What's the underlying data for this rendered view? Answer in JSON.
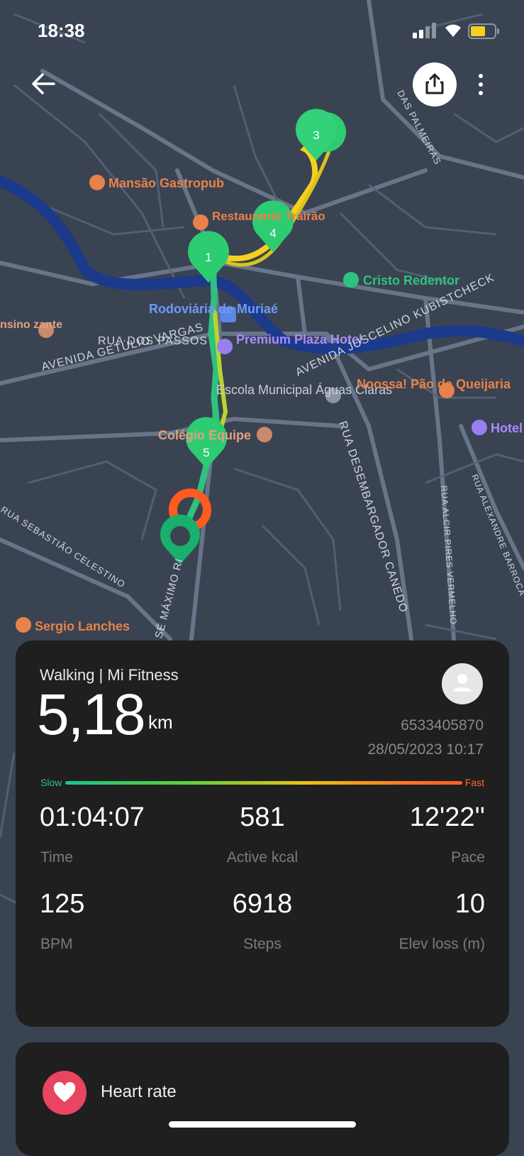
{
  "status_bar": {
    "time": "18:38"
  },
  "map": {
    "pois": [
      {
        "name": "Mansão Gastropub",
        "icon": "restaurant-icon"
      },
      {
        "name": "Restaurante Trairão",
        "icon": "restaurant-icon"
      },
      {
        "name": "Rodoviária de Muriaé",
        "icon": "bus-icon"
      },
      {
        "name": "Premium Plaza Hotel",
        "icon": "hotel-icon"
      },
      {
        "name": "Cristo Redentor",
        "icon": "park-icon"
      },
      {
        "name": "Escola Municipal Águas Claras",
        "icon": "school-icon"
      },
      {
        "name": "Noossa! Pão de Queijaria",
        "icon": "food-icon"
      },
      {
        "name": "Colégio Equipe",
        "icon": "school-icon"
      },
      {
        "name": "Sergio Lanches",
        "icon": "restaurant-icon"
      },
      {
        "name": "Hotel",
        "icon": "hotel-icon"
      },
      {
        "name": "nsino zante",
        "icon": "school-icon"
      }
    ],
    "streets": [
      "RUA DOS PASSOS",
      "AVENIDA GETÚLIO VARGAS",
      "AVENIDA JUSCELINO KUBISTCHECK",
      "RUA DESEMBARGADOR CANEDO",
      "RUA SEBASTIÃO CELESTINO",
      "RUA ALCIR PIRES VERMELHO",
      "RUA ALEXANDRE BARROCA",
      "DAS PALMEIRAS",
      "SÉ MÁXIMO RI"
    ],
    "markers": [
      "1",
      "3",
      "4",
      "5"
    ],
    "colors": {
      "route_slow": "#2ec27e",
      "route_fast": "#f5d020",
      "start": "#ff5a1f",
      "marker": "#2ecc71"
    }
  },
  "summary": {
    "activity": "Walking | Mi Fitness",
    "distance": "5,18",
    "unit": "km",
    "user_id": "6533405870",
    "datetime": "28/05/2023 10:17",
    "speed_slow": "Slow",
    "speed_fast": "Fast",
    "stats": [
      {
        "value": "01:04:07",
        "label": "Time"
      },
      {
        "value": "581",
        "label": "Active kcal"
      },
      {
        "value": "12'22''",
        "label": "Pace"
      },
      {
        "value": "125",
        "label": "BPM"
      },
      {
        "value": "6918",
        "label": "Steps"
      },
      {
        "value": "10",
        "label": "Elev loss (m)"
      }
    ]
  },
  "heart_rate": {
    "label": "Heart rate"
  }
}
